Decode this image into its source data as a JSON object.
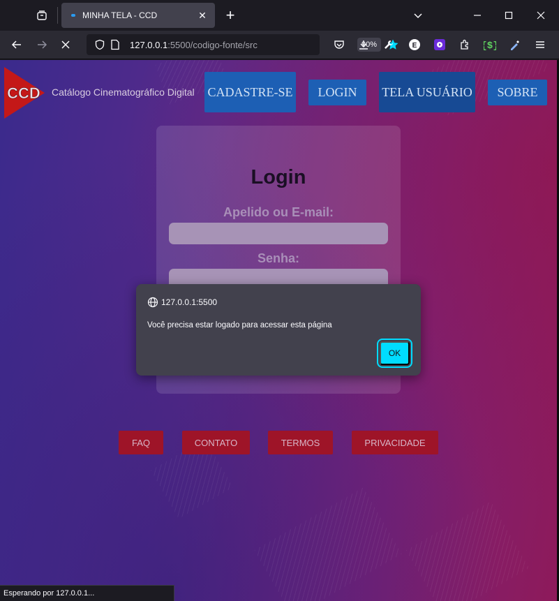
{
  "browser": {
    "tab_title": "MINHA TELA - CCD",
    "url_host": "127.0.0.1",
    "url_rest": ":5500/codigo-fonte/src",
    "zoom": "90%",
    "status_text": "Esperando por 127.0.0.1..."
  },
  "site": {
    "logo_text": "CCD",
    "title": "Catálogo Cinematográfico Digital",
    "nav": {
      "signup": "CADASTRE-SE",
      "login": "LOGIN",
      "user_screen": "TELA USUÁRIO",
      "about": "SOBRE"
    }
  },
  "login_card": {
    "heading": "Login",
    "username_label": "Apelido ou E-mail:",
    "password_label": "Senha:"
  },
  "footer": {
    "faq": "FAQ",
    "contact": "CONTATO",
    "terms": "TERMOS",
    "privacy": "PRIVACIDADE"
  },
  "alert": {
    "origin": "127.0.0.1:5500",
    "message": "Você precisa estar logado para acessar esta página",
    "ok_label": "OK"
  },
  "colors": {
    "nav_button": "#1d5fb4",
    "footer_button": "#9e1428",
    "alert_ok": "#00ddff"
  }
}
